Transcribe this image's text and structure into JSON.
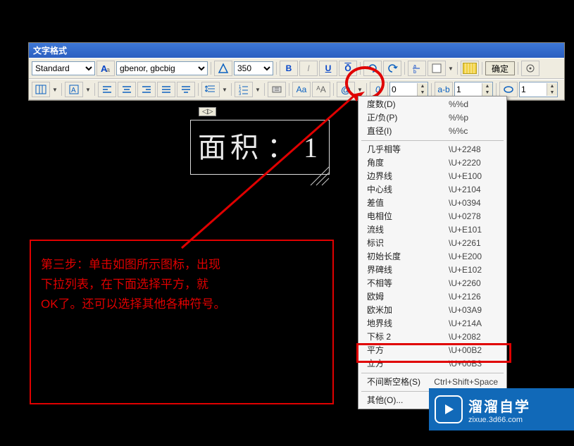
{
  "panel": {
    "title": "文字格式",
    "style": "Standard",
    "font": "gbenor, gbcbig",
    "height": "350",
    "ok": "确定"
  },
  "row2": {
    "atLabel": "@",
    "slashLabel": "0/",
    "tracking": "0",
    "abLabel": "a-b",
    "widthFactor": "1",
    "oblique": "1"
  },
  "sample": {
    "tab": "◁▷",
    "text_a": "面积",
    "text_b": "：",
    "text_c": "1"
  },
  "instruction": {
    "line1": "第三步：单击如图所示图标，出现",
    "line2": "下拉列表，在下面选择平方，就",
    "line3": "OK了。还可以选择其他各种符号。"
  },
  "menu": {
    "groups": [
      {
        "items": [
          {
            "label": "度数(D)",
            "code": "%%d"
          },
          {
            "label": "正/负(P)",
            "code": "%%p"
          },
          {
            "label": "直径(I)",
            "code": "%%c"
          }
        ]
      },
      {
        "items": [
          {
            "label": "几乎相等",
            "code": "\\U+2248"
          },
          {
            "label": "角度",
            "code": "\\U+2220"
          },
          {
            "label": "边界线",
            "code": "\\U+E100"
          },
          {
            "label": "中心线",
            "code": "\\U+2104"
          },
          {
            "label": "差值",
            "code": "\\U+0394"
          },
          {
            "label": "电相位",
            "code": "\\U+0278"
          },
          {
            "label": "流线",
            "code": "\\U+E101"
          },
          {
            "label": "标识",
            "code": "\\U+2261"
          },
          {
            "label": "初始长度",
            "code": "\\U+E200"
          },
          {
            "label": "界碑线",
            "code": "\\U+E102"
          },
          {
            "label": "不相等",
            "code": "\\U+2260"
          },
          {
            "label": "欧姆",
            "code": "\\U+2126"
          },
          {
            "label": "欧米加",
            "code": "\\U+03A9"
          },
          {
            "label": "地界线",
            "code": "\\U+214A"
          },
          {
            "label": "下标 2",
            "code": "\\U+2082"
          },
          {
            "label": "平方",
            "code": "\\U+00B2"
          },
          {
            "label": "立方",
            "code": "\\U+00B3"
          }
        ]
      },
      {
        "items": [
          {
            "label": "不间断空格(S)",
            "code": "Ctrl+Shift+Space"
          }
        ]
      },
      {
        "items": [
          {
            "label": "其他(O)...",
            "code": ""
          }
        ]
      }
    ]
  },
  "watermark": {
    "main": "溜溜自学",
    "sub": "zixue.3d66.com"
  }
}
